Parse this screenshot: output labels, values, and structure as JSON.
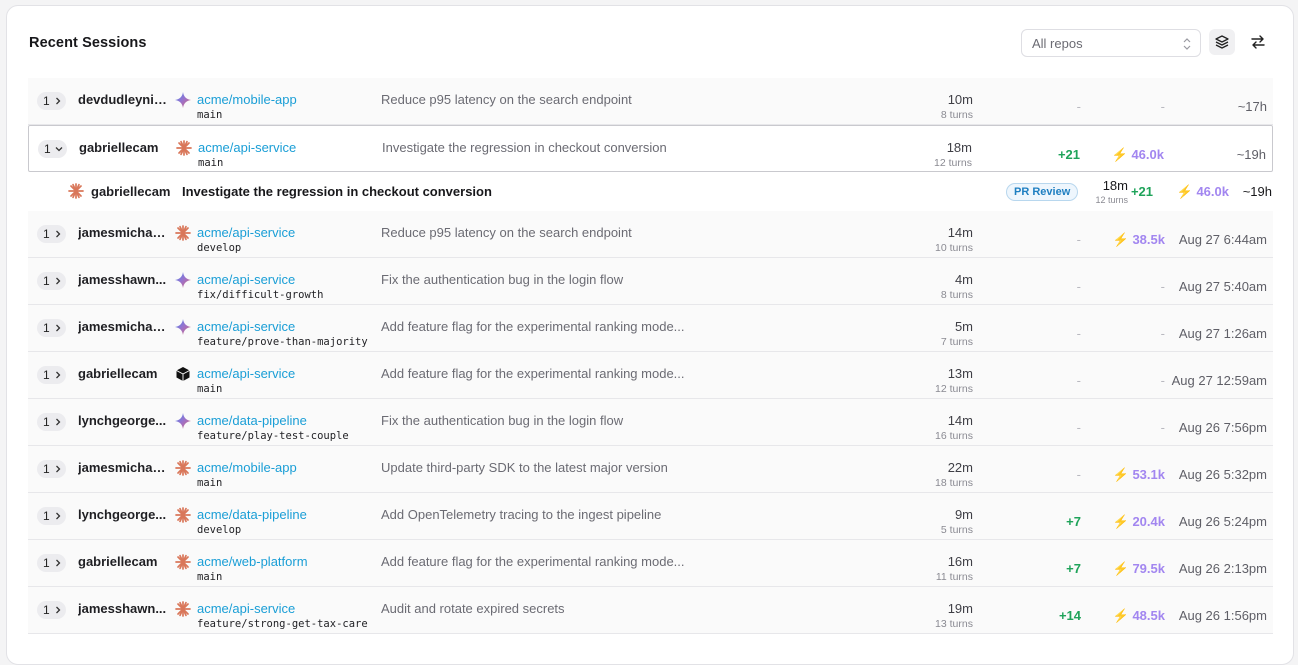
{
  "header": {
    "title": "Recent Sessions",
    "repo_filter": "All repos"
  },
  "colors": {
    "repo_link": "#1a9ed6",
    "diff_positive": "#1fa35a",
    "tokens": "#a286f0",
    "pr_badge": "#1f7fc1"
  },
  "rows": [
    {
      "count": "1",
      "user": "devdudleynic...",
      "agent": "sparkle-icon",
      "repo": "acme/mobile-app",
      "branch": "main",
      "task": "Reduce p95 latency on the search endpoint",
      "duration": "10m",
      "turns": "8 turns",
      "diff": "-",
      "tokens": "-",
      "when": "~17h"
    },
    {
      "count": "1",
      "user": "gabriellecam",
      "agent": "burst-icon",
      "repo": "acme/api-service",
      "branch": "main",
      "task": "Investigate the regression in checkout conversion",
      "duration": "18m",
      "turns": "12 turns",
      "diff": "+21",
      "tokens": "46.0k",
      "when": "~19h",
      "expanded": true
    },
    {
      "count": "1",
      "user": "jamesmichae...",
      "agent": "burst-icon",
      "repo": "acme/api-service",
      "branch": "develop",
      "task": "Reduce p95 latency on the search endpoint",
      "duration": "14m",
      "turns": "10 turns",
      "diff": "-",
      "tokens": "38.5k",
      "when": "Aug 27 6:44am"
    },
    {
      "count": "1",
      "user": "jamesshawn...",
      "agent": "sparkle-icon",
      "repo": "acme/api-service",
      "branch": "fix/difficult-growth",
      "task": "Fix the authentication bug in the login flow",
      "duration": "4m",
      "turns": "8 turns",
      "diff": "-",
      "tokens": "-",
      "when": "Aug 27 5:40am"
    },
    {
      "count": "1",
      "user": "jamesmichae...",
      "agent": "sparkle-icon",
      "repo": "acme/api-service",
      "branch": "feature/prove-than-majority",
      "task": "Add feature flag for the experimental ranking mode...",
      "duration": "5m",
      "turns": "7 turns",
      "diff": "-",
      "tokens": "-",
      "when": "Aug 27 1:26am"
    },
    {
      "count": "1",
      "user": "gabriellecam",
      "agent": "cube-icon",
      "repo": "acme/api-service",
      "branch": "main",
      "task": "Add feature flag for the experimental ranking mode...",
      "duration": "13m",
      "turns": "12 turns",
      "diff": "-",
      "tokens": "-",
      "when": "Aug 27 12:59am"
    },
    {
      "count": "1",
      "user": "lynchgeorge...",
      "agent": "sparkle-icon",
      "repo": "acme/data-pipeline",
      "branch": "feature/play-test-couple",
      "task": "Fix the authentication bug in the login flow",
      "duration": "14m",
      "turns": "16 turns",
      "diff": "-",
      "tokens": "-",
      "when": "Aug 26 7:56pm"
    },
    {
      "count": "1",
      "user": "jamesmichae...",
      "agent": "burst-icon",
      "repo": "acme/mobile-app",
      "branch": "main",
      "task": "Update third-party SDK to the latest major version",
      "duration": "22m",
      "turns": "18 turns",
      "diff": "-",
      "tokens": "53.1k",
      "when": "Aug 26 5:32pm"
    },
    {
      "count": "1",
      "user": "lynchgeorge...",
      "agent": "burst-icon",
      "repo": "acme/data-pipeline",
      "branch": "develop",
      "task": "Add OpenTelemetry tracing to the ingest pipeline",
      "duration": "9m",
      "turns": "5 turns",
      "diff": "+7",
      "tokens": "20.4k",
      "when": "Aug 26 5:24pm"
    },
    {
      "count": "1",
      "user": "gabriellecam",
      "agent": "burst-icon",
      "repo": "acme/web-platform",
      "branch": "main",
      "task": "Add feature flag for the experimental ranking mode...",
      "duration": "16m",
      "turns": "11 turns",
      "diff": "+7",
      "tokens": "79.5k",
      "when": "Aug 26 2:13pm"
    },
    {
      "count": "1",
      "user": "jamesshawn...",
      "agent": "burst-icon",
      "repo": "acme/api-service",
      "branch": "feature/strong-get-tax-care",
      "task": "Audit and rotate expired secrets",
      "duration": "19m",
      "turns": "13 turns",
      "diff": "+14",
      "tokens": "48.5k",
      "when": "Aug 26 1:56pm"
    }
  ],
  "expanded_detail": {
    "agent": "burst-icon",
    "user": "gabriellecam",
    "task": "Investigate the regression in checkout conversion",
    "badge": "PR Review",
    "duration": "18m",
    "turns": "12 turns",
    "diff": "+21",
    "tokens": "46.0k",
    "when": "~19h"
  }
}
